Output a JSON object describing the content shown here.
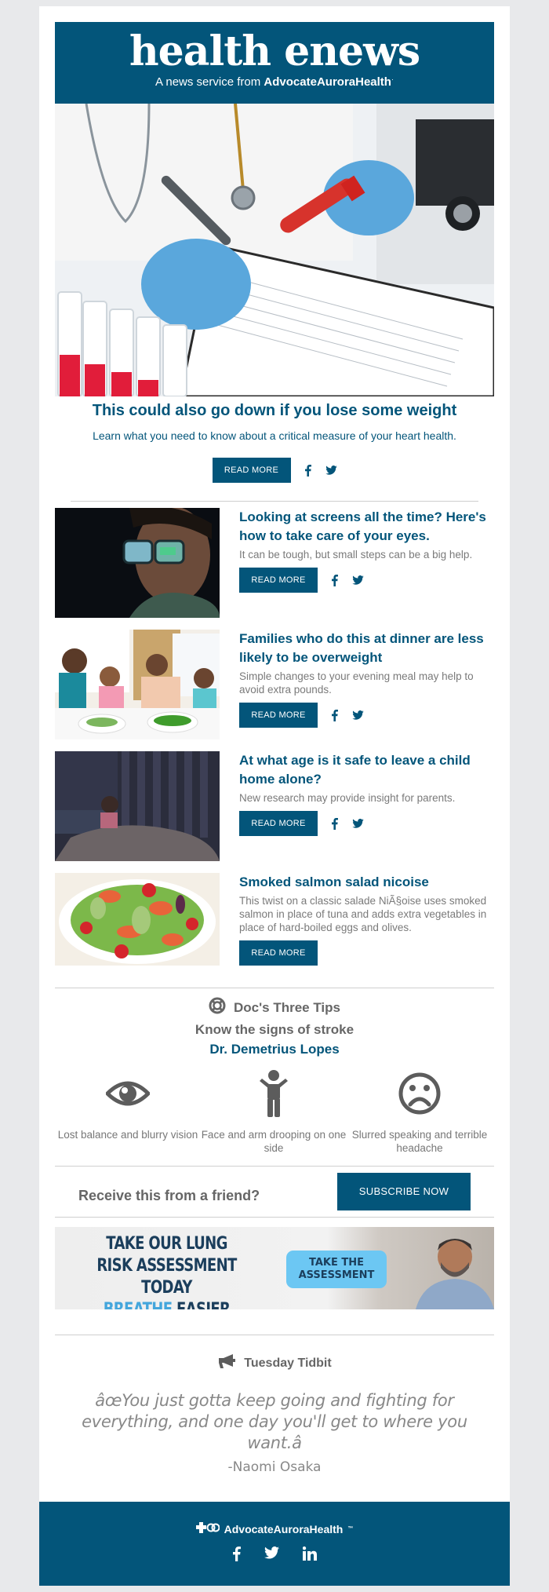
{
  "masthead": {
    "logo": "health enews",
    "tagline_prefix": "A news service from ",
    "tagline_brand": "AdvocateAuroraHealth",
    "tagline_mark": "·"
  },
  "hero": {
    "image_alt": "gloved hands holding blood sample tube and pen over lab form",
    "title": "This could also go down if you lose some weight",
    "description": "Learn what you need to know about a critical measure of your heart health.",
    "button": "READ MORE",
    "share": [
      "facebook-icon",
      "twitter-icon"
    ]
  },
  "articles": [
    {
      "image_alt": "man wearing glasses reflecting a screen",
      "title": "Looking at screens all the time? Here's how to take care of your eyes.",
      "description": "It can be tough, but small steps can be a big help.",
      "button": "READ MORE",
      "has_share": true
    },
    {
      "image_alt": "family eating dinner together",
      "title": "Families who do this at dinner are less likely to be overweight",
      "description": "Simple changes to your evening meal may help to avoid extra pounds.",
      "button": "READ MORE",
      "has_share": true
    },
    {
      "image_alt": "child alone in a dark room with a stuffed toy",
      "title": "At what age is it safe to leave a child home alone?",
      "description": "New research may provide insight for parents.",
      "button": "READ MORE",
      "has_share": true
    },
    {
      "image_alt": "smoked salmon salad",
      "title": "Smoked salmon salad nicoise",
      "description": "This twist on a classic salade NiÃ§oise uses smoked salmon in place of tuna and adds extra vegetables in place of hard-boiled eggs and olives.",
      "button": "READ MORE",
      "has_share": false
    }
  ],
  "tips": {
    "icon": "lifebuoy-icon",
    "heading": "Doc's Three Tips",
    "subheading": "Know the signs of stroke",
    "doctor": "Dr. Demetrius Lopes",
    "items": [
      {
        "icon": "eye-icon",
        "text": "Lost balance and blurry vision"
      },
      {
        "icon": "person-arms-up-icon",
        "text": "Face and arm drooping on one side"
      },
      {
        "icon": "sad-face-icon",
        "text": "Slurred speaking and terrible headache"
      }
    ]
  },
  "subscribe": {
    "question": "Receive this from a friend?",
    "button": "SUBSCRIBE NOW"
  },
  "banner": {
    "line1": "TAKE OUR LUNG",
    "line2": "RISK ASSESSMENT TODAY",
    "line3_highlight": "BREATHE",
    "line3_rest": " EASIER",
    "cta_line1": "TAKE THE",
    "cta_line2": "ASSESSMENT"
  },
  "tidbit": {
    "icon": "megaphone-icon",
    "heading": "Tuesday Tidbit",
    "quote": "âœYou just gotta keep going and fighting for everything, and one day you'll get to where you want.â",
    "author": "-Naomi Osaka"
  },
  "footer": {
    "brand": "AdvocateAuroraHealth",
    "trademark": "™",
    "social": [
      "facebook-icon",
      "twitter-icon",
      "linkedin-icon"
    ]
  },
  "colors": {
    "brand_blue": "#03557a",
    "page_background": "#e8e9eb",
    "banner_cta": "#6cc7f3",
    "body_gray": "#7a7a7a"
  }
}
